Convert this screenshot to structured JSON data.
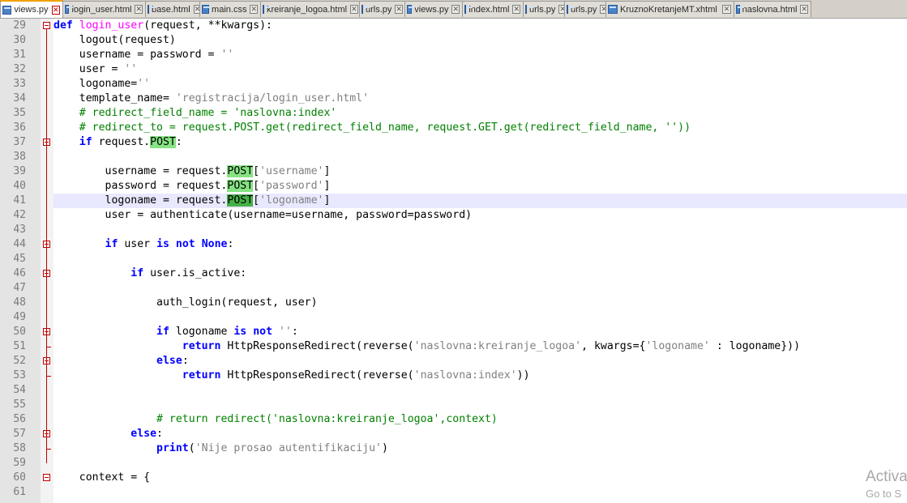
{
  "tabs": [
    {
      "label": "views.py",
      "active": true
    },
    {
      "label": "login_user.html"
    },
    {
      "label": "base.html"
    },
    {
      "label": "main.css"
    },
    {
      "label": "kreiranje_logoa.html"
    },
    {
      "label": "urls.py"
    },
    {
      "label": "views.py"
    },
    {
      "label": "index.html"
    },
    {
      "label": "urls.py"
    },
    {
      "label": "urls.py"
    },
    {
      "label": "KruznoKretanjeMT.xhtml"
    },
    {
      "label": "naslovna.html"
    }
  ],
  "editor": {
    "current_line": 41,
    "lines": [
      {
        "n": "29",
        "text": "def login_user(request, **kwargs):"
      },
      {
        "n": "30",
        "text": "    logout(request)"
      },
      {
        "n": "31",
        "text": "    username = password = ''"
      },
      {
        "n": "32",
        "text": "    user = ''"
      },
      {
        "n": "33",
        "text": "    logoname=''"
      },
      {
        "n": "34",
        "text": "    template_name= 'registracija/login_user.html'"
      },
      {
        "n": "35",
        "text": "    # redirect_field_name = 'naslovna:index'"
      },
      {
        "n": "36",
        "text": "    # redirect_to = request.POST.get(redirect_field_name, request.GET.get(redirect_field_name, ''))"
      },
      {
        "n": "37",
        "text": "    if request.POST:"
      },
      {
        "n": "38",
        "text": ""
      },
      {
        "n": "39",
        "text": "        username = request.POST['username']"
      },
      {
        "n": "40",
        "text": "        password = request.POST['password']"
      },
      {
        "n": "41",
        "text": "        logoname = request.POST['logoname']"
      },
      {
        "n": "42",
        "text": "        user = authenticate(username=username, password=password)"
      },
      {
        "n": "43",
        "text": ""
      },
      {
        "n": "44",
        "text": "        if user is not None:"
      },
      {
        "n": "45",
        "text": ""
      },
      {
        "n": "46",
        "text": "            if user.is_active:"
      },
      {
        "n": "47",
        "text": ""
      },
      {
        "n": "48",
        "text": "                auth_login(request, user)"
      },
      {
        "n": "49",
        "text": ""
      },
      {
        "n": "50",
        "text": "                if logoname is not '':"
      },
      {
        "n": "51",
        "text": "                    return HttpResponseRedirect(reverse('naslovna:kreiranje_logoa', kwargs={'logoname' : logoname}))"
      },
      {
        "n": "52",
        "text": "                else:"
      },
      {
        "n": "53",
        "text": "                    return HttpResponseRedirect(reverse('naslovna:index'))"
      },
      {
        "n": "54",
        "text": ""
      },
      {
        "n": "55",
        "text": ""
      },
      {
        "n": "56",
        "text": "                # return redirect('naslovna:kreiranje_logoa',context)"
      },
      {
        "n": "57",
        "text": "            else:"
      },
      {
        "n": "58",
        "text": "                print('Nije prosao autentifikaciju')"
      },
      {
        "n": "59",
        "text": ""
      },
      {
        "n": "60",
        "text": "    context = {"
      },
      {
        "n": "61",
        "text": ""
      }
    ]
  },
  "watermark": {
    "line1": "Activa",
    "line2": "Go to S"
  },
  "colors": {
    "keyword": "#0000ff",
    "function_name": "#ff00ff",
    "string": "#808080",
    "comment": "#008000",
    "word_highlight": "#86e383",
    "current_line": "#e8e8ff",
    "fold_marker": "#c00000",
    "active_tab_accent": "#f2a000"
  },
  "icons": {
    "tab": "file-icon",
    "tab_close": "close-icon",
    "fold": "fold-minus-icon"
  }
}
